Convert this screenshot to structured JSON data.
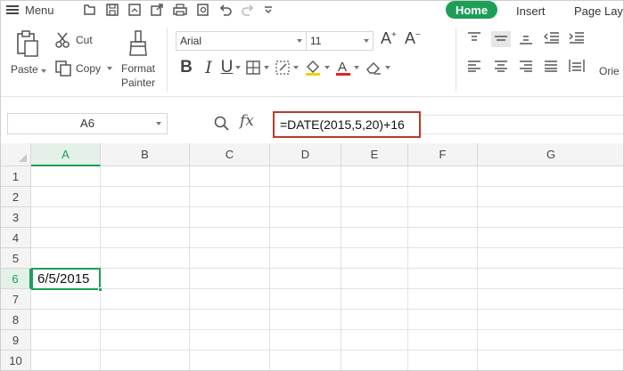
{
  "topbar": {
    "menu_label": "Menu",
    "tabs": {
      "home": "Home",
      "insert": "Insert",
      "page_layout": "Page Layo"
    }
  },
  "ribbon": {
    "clipboard": {
      "paste": "Paste",
      "cut": "Cut",
      "copy": "Copy",
      "format_painter_line1": "Format",
      "format_painter_line2": "Painter"
    },
    "font": {
      "name": "Arial",
      "size": "11"
    },
    "orientation_label": "Orie"
  },
  "formula_bar": {
    "name_box": "A6",
    "fx_label": "fx",
    "formula": "=DATE(2015,5,20)+16"
  },
  "grid": {
    "columns": [
      "A",
      "B",
      "C",
      "D",
      "E",
      "F",
      "G"
    ],
    "rows": [
      "1",
      "2",
      "3",
      "4",
      "5",
      "6",
      "7",
      "8",
      "9",
      "10"
    ],
    "active_cell": {
      "ref": "A6",
      "value": "6/5/2015"
    }
  },
  "colors": {
    "accent_green": "#1e9f57",
    "formula_highlight": "#c0392b"
  },
  "icons": [
    "menu-icon",
    "open-icon",
    "save-icon",
    "save-as-icon",
    "export-icon",
    "print-icon",
    "print-preview-icon",
    "undo-icon",
    "redo-icon",
    "customize-icon",
    "paste-icon",
    "cut-icon",
    "copy-icon",
    "format-painter-icon",
    "grow-font-icon",
    "shrink-font-icon",
    "borders-icon",
    "fill-color-icon",
    "font-color-icon",
    "clear-format-icon",
    "zoom-icon",
    "fx-icon"
  ]
}
